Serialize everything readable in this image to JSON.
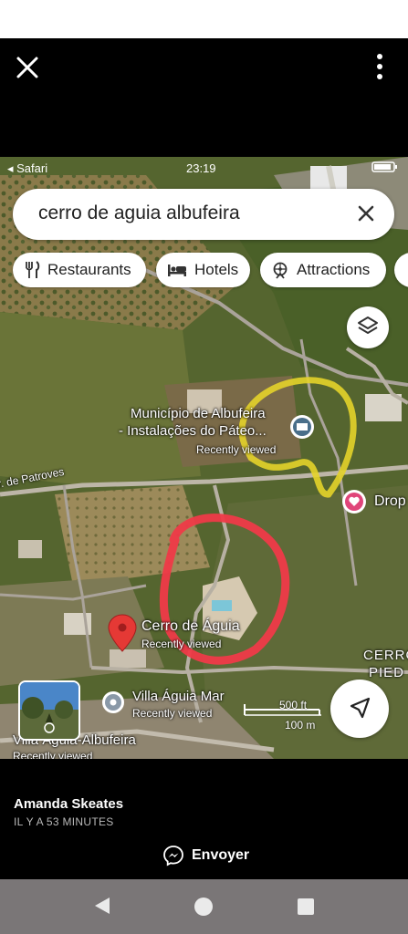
{
  "viewer": {
    "close_icon": "close-icon",
    "more_icon": "more-vertical-icon",
    "author": "Amanda Skeates",
    "time_ago": "IL Y A 53 MINUTES",
    "send_label": "Envoyer",
    "send_icon": "messenger-icon"
  },
  "ios_status": {
    "carrier": "◂ Safari",
    "time": "23:19"
  },
  "maps": {
    "search_text": "cerro de aguia albufeira",
    "chips": [
      {
        "label": "Restaurants",
        "icon": "fork-knife-icon"
      },
      {
        "label": "Hotels",
        "icon": "bed-icon"
      },
      {
        "label": "Attractions",
        "icon": "attraction-icon"
      }
    ],
    "places": {
      "municipio_line1": "Município de Albufeira",
      "municipio_line2": "- Instalações do Páteo...",
      "municipio_sub": "Recently viewed",
      "road": "r. de Patroves",
      "drop": "Drop",
      "cerro_name": "Cerro de Águia",
      "cerro_sub": "Recently viewed",
      "villa_mar": "Villa Águia Mar",
      "villa_mar_sub": "Recently viewed",
      "villa_albufeira": "Villa Águia-Albufeira",
      "villa_albufeira_sub": "Recently viewed",
      "cerro_b1": "CERRO",
      "cerro_b2": "PIED"
    },
    "scale_ft": "500 ft",
    "scale_m": "100 m",
    "colors": {
      "marker_red": "#e53935",
      "annotation_red": "#ef3a48",
      "annotation_yellow": "#e4d32a",
      "attraction_blue": "#4a6f8a"
    }
  },
  "android_nav": {
    "back_icon": "back-triangle-icon",
    "home_icon": "home-circle-icon",
    "recents_icon": "recents-square-icon"
  }
}
